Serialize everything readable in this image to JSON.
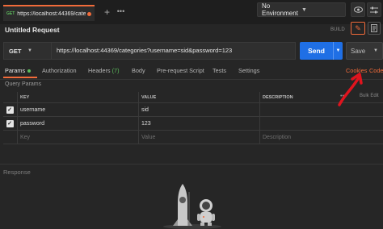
{
  "tabbar": {
    "tab": {
      "method": "GET",
      "url": "https://localhost:44369/categor..."
    },
    "new_tab": "+",
    "more": "•••"
  },
  "environment": {
    "selected": "No Environment"
  },
  "request": {
    "title": "Untitled Request",
    "build_label": "BUILD",
    "method": "GET",
    "url": "https://localhost:44369/categories?username=sid&password=123",
    "send_label": "Send",
    "save_label": "Save"
  },
  "req_tabs": {
    "params": "Params",
    "authorization": "Authorization",
    "headers": "Headers",
    "headers_count": "(7)",
    "body": "Body",
    "prerequest": "Pre-request Script",
    "tests": "Tests",
    "settings": "Settings",
    "cookies": "Cookies",
    "code": "Code"
  },
  "query_params": {
    "title": "Query Params",
    "columns": {
      "key": "KEY",
      "value": "VALUE",
      "description": "DESCRIPTION"
    },
    "more": "•••",
    "bulk_edit": "Bulk Edit",
    "rows": [
      {
        "key": "username",
        "value": "sid",
        "description": ""
      },
      {
        "key": "password",
        "value": "123",
        "description": ""
      }
    ],
    "placeholders": {
      "key": "Key",
      "value": "Value",
      "description": "Description"
    }
  },
  "response": {
    "label": "Response"
  },
  "colors": {
    "accent": "#f26b3a",
    "send": "#1f6fe5",
    "active": "#5dbf5d",
    "annotation": "#e0141e"
  },
  "icons": [
    "eye-icon",
    "sliders-icon",
    "pencil-icon",
    "document-icon",
    "chevron-down-icon",
    "checkbox-icon",
    "astronaut-illustration"
  ]
}
